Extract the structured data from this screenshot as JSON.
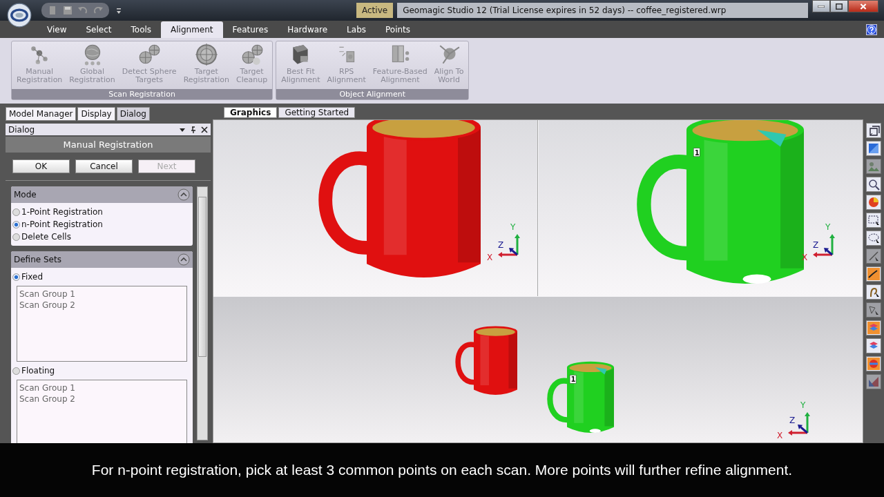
{
  "title_bar": {
    "status": "Active",
    "title": "Geomagic Studio 12 (Trial License expires in 52 days) -- coffee_registered.wrp"
  },
  "ribbon_tabs": [
    {
      "label": "View",
      "selected": false
    },
    {
      "label": "Select",
      "selected": false
    },
    {
      "label": "Tools",
      "selected": false
    },
    {
      "label": "Alignment",
      "selected": true
    },
    {
      "label": "Features",
      "selected": false
    },
    {
      "label": "Hardware",
      "selected": false
    },
    {
      "label": "Labs",
      "selected": false
    },
    {
      "label": "Points",
      "selected": false
    }
  ],
  "ribbon_groups": [
    {
      "label": "Scan Registration",
      "buttons": [
        {
          "label": "Manual\nRegistration",
          "disabled": true
        },
        {
          "label": "Global\nRegistration",
          "disabled": true
        },
        {
          "label": "Detect Sphere\nTargets",
          "disabled": true
        },
        {
          "label": "Target\nRegistration",
          "disabled": true
        },
        {
          "label": "Target\nCleanup",
          "disabled": true
        }
      ]
    },
    {
      "label": "Object Alignment",
      "buttons": [
        {
          "label": "Best Fit\nAlignment",
          "disabled": true
        },
        {
          "label": "RPS\nAlignment",
          "disabled": true
        },
        {
          "label": "Feature-Based\nAlignment",
          "disabled": true
        },
        {
          "label": "Align To\nWorld",
          "disabled": true
        }
      ]
    }
  ],
  "panel_tabs": [
    {
      "label": "Model Manager",
      "selected": false
    },
    {
      "label": "Display",
      "selected": false
    },
    {
      "label": "Dialog",
      "selected": true
    }
  ],
  "dialog": {
    "header": "Dialog",
    "title": "Manual Registration",
    "buttons": [
      {
        "label": "OK",
        "disabled": false
      },
      {
        "label": "Cancel",
        "disabled": false
      },
      {
        "label": "Next",
        "disabled": true
      }
    ],
    "mode": {
      "title": "Mode",
      "expanded": true,
      "options": [
        {
          "label": "1-Point Registration",
          "selected": false
        },
        {
          "label": "n-Point Registration",
          "selected": true
        },
        {
          "label": "Delete Cells",
          "selected": false
        }
      ]
    },
    "define_sets": {
      "title": "Define Sets",
      "expanded": true,
      "sets": [
        {
          "label": "Fixed",
          "selected": true,
          "items": [
            "Scan Group 1",
            "Scan Group 2"
          ]
        },
        {
          "label": "Floating",
          "selected": false,
          "items": [
            "Scan Group 1",
            "Scan Group 2"
          ]
        }
      ]
    }
  },
  "view_tabs": [
    {
      "label": "Graphics",
      "selected": true
    },
    {
      "label": "Getting Started",
      "selected": false
    }
  ],
  "viewports": [
    {
      "meshes": [
        {
          "color": "#e01010"
        }
      ],
      "axes": [
        {
          "label": "X",
          "color": "#d02030"
        },
        {
          "label": "Y",
          "color": "#20b040"
        },
        {
          "label": "Z",
          "color": "#1a1a90"
        }
      ]
    },
    {
      "meshes": [
        {
          "color": "#20d020",
          "marker": "1"
        }
      ],
      "axes": [
        {
          "label": "X",
          "color": "#d02030"
        },
        {
          "label": "Y",
          "color": "#20b040"
        },
        {
          "label": "Z",
          "color": "#1a1a90"
        }
      ]
    },
    {
      "meshes": [
        {
          "color": "#e01010"
        },
        {
          "color": "#20d020",
          "marker": "1"
        }
      ],
      "axes": [
        {
          "label": "X",
          "color": "#d02030"
        },
        {
          "label": "Y",
          "color": "#20b040"
        },
        {
          "label": "Z",
          "color": "#1a1a90"
        }
      ]
    }
  ],
  "toolbar": [
    {
      "disabled": false
    },
    {
      "disabled": false
    },
    {
      "disabled": true
    },
    {
      "disabled": false
    },
    {
      "disabled": false
    },
    {
      "disabled": false
    },
    {
      "disabled": false
    },
    {
      "disabled": true
    },
    {
      "disabled": false
    },
    {
      "disabled": false
    },
    {
      "disabled": true
    },
    {
      "disabled": false
    },
    {
      "disabled": false
    },
    {
      "disabled": false
    },
    {
      "disabled": true
    }
  ],
  "caption": "For n-point registration, pick at least 3 common points on each scan. More points will further refine alignment."
}
